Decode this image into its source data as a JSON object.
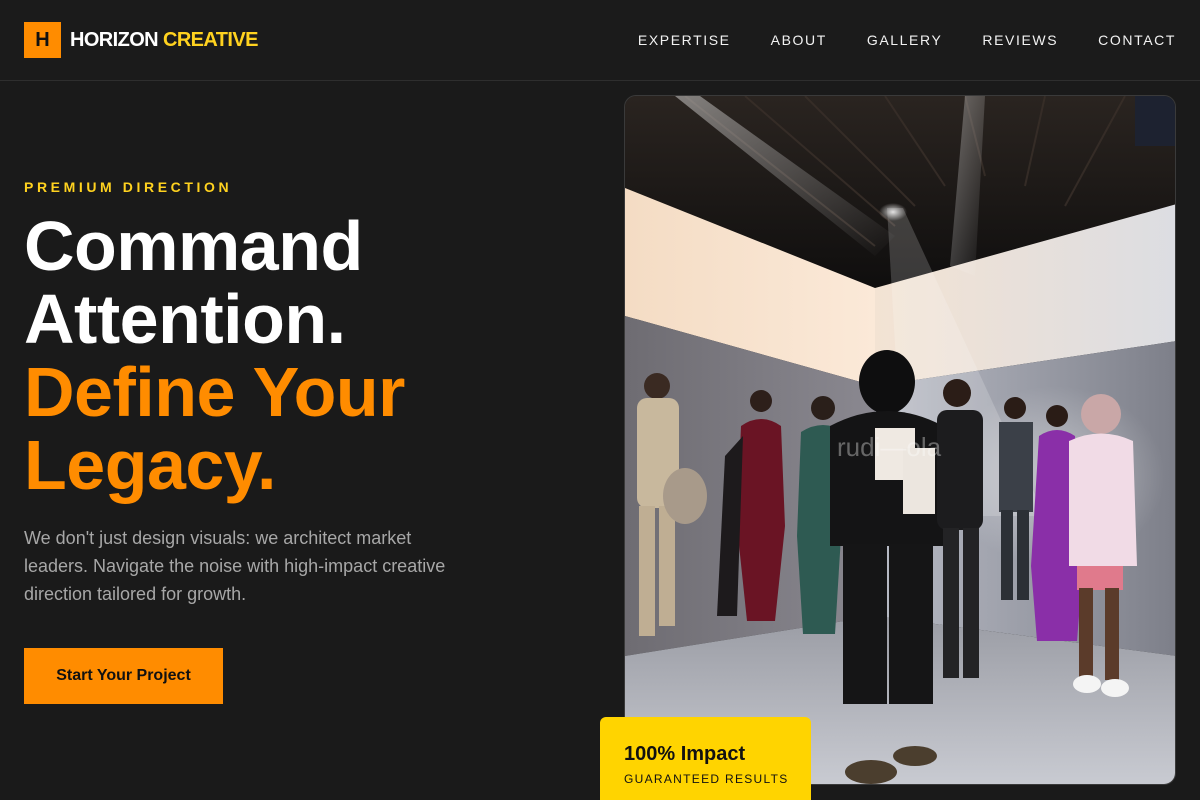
{
  "brand": {
    "logo_letter": "H",
    "name_part1": "HORIZON",
    "name_part2": "CREATIVE"
  },
  "nav": {
    "items": [
      {
        "label": "EXPERTISE"
      },
      {
        "label": "ABOUT"
      },
      {
        "label": "GALLERY"
      },
      {
        "label": "REVIEWS"
      },
      {
        "label": "CONTACT"
      }
    ]
  },
  "hero": {
    "eyebrow": "PREMIUM DIRECTION",
    "headline_lines": [
      "Command",
      "Attention."
    ],
    "headline_accent_lines": [
      "Define Your",
      "Legacy."
    ],
    "description": "We don't just design visuals: we architect market leaders. Navigate the noise with high-impact creative direction tailored for growth.",
    "cta_label": "Start Your Project",
    "image_watermark": "rudi—ola"
  },
  "badge": {
    "title": "100% Impact",
    "subtitle": "GUARANTEED RESULTS"
  },
  "colors": {
    "background": "#1a1a1a",
    "accent_orange": "#ff8c00",
    "accent_yellow": "#ffd21f",
    "badge_yellow": "#ffd400",
    "muted_text": "#a7a7a7"
  }
}
